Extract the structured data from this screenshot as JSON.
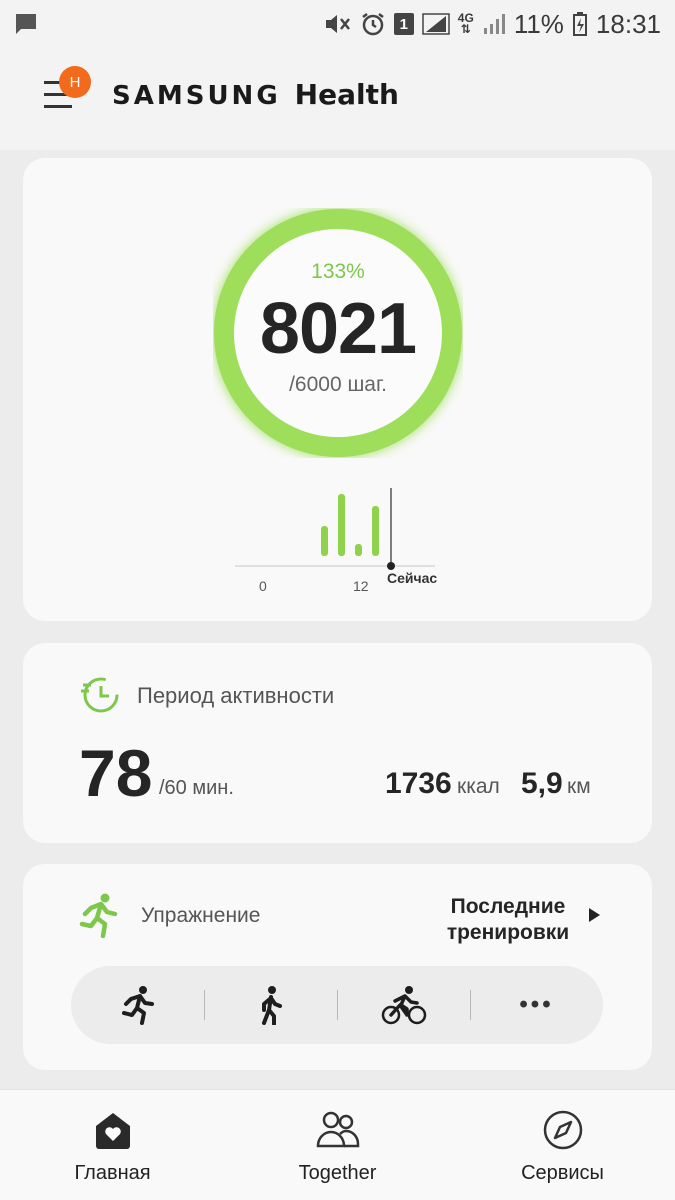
{
  "status_bar": {
    "battery": "11%",
    "time": "18:31",
    "sim": "1",
    "network": "4G"
  },
  "header": {
    "brand_samsung": "SAMSUNG",
    "brand_health": "Health",
    "menu_badge": "H",
    "badge_color": "#f26a1b"
  },
  "steps": {
    "percent": "133%",
    "count": "8021",
    "goal": "/6000 шаг.",
    "progress_fraction": 1.0,
    "ring_color": "#9ede5a",
    "chart": {
      "label_start": "0",
      "label_mid": "12",
      "label_now": "Сейчас",
      "bars": [
        0.35,
        0.8,
        0.15,
        0.65
      ]
    }
  },
  "activity": {
    "title": "Период активности",
    "value": "78",
    "goal": "/60 мин.",
    "kcal_value": "1736",
    "kcal_unit": "ккал",
    "distance_value": "5,9",
    "distance_unit": "км"
  },
  "exercise": {
    "title": "Упражнение",
    "recent_line1": "Последние",
    "recent_line2": "тренировки",
    "more": "•••"
  },
  "nav": {
    "home": "Главная",
    "together": "Together",
    "services": "Сервисы"
  },
  "accent_green": "#7dc84a"
}
